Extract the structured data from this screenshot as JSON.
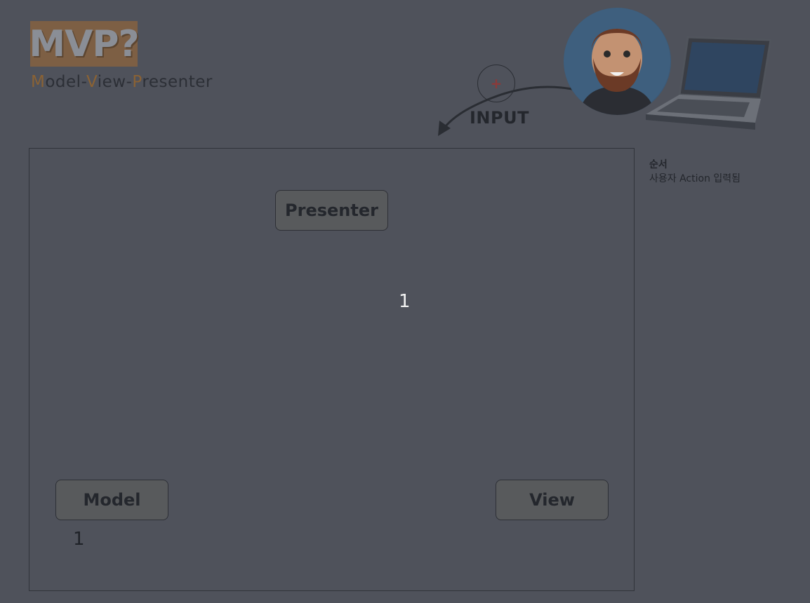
{
  "logo": {
    "text": "MVP?"
  },
  "subtitle": {
    "parts": [
      {
        "text": "M",
        "hl": true
      },
      {
        "text": "odel-",
        "hl": false
      },
      {
        "text": "V",
        "hl": true
      },
      {
        "text": "iew-",
        "hl": false
      },
      {
        "text": "P",
        "hl": true
      },
      {
        "text": "resenter",
        "hl": false
      }
    ]
  },
  "input": {
    "plus": "+",
    "label": "INPUT"
  },
  "nodes": {
    "presenter": "Presenter",
    "model": "Model",
    "view": "View"
  },
  "counters": {
    "presenter": "1",
    "model": "1"
  },
  "order": {
    "title": "순서",
    "text": "사용자 Action 입력됨"
  },
  "colors": {
    "background": "#4f525b",
    "logo_bg": "#7d5f44",
    "accent_letter": "#8a6234",
    "plus": "#8a3a3a"
  },
  "icons": {
    "avatar": "bearded-man-avatar-icon",
    "laptop": "laptop-icon",
    "arrow": "curved-arrow-icon"
  }
}
